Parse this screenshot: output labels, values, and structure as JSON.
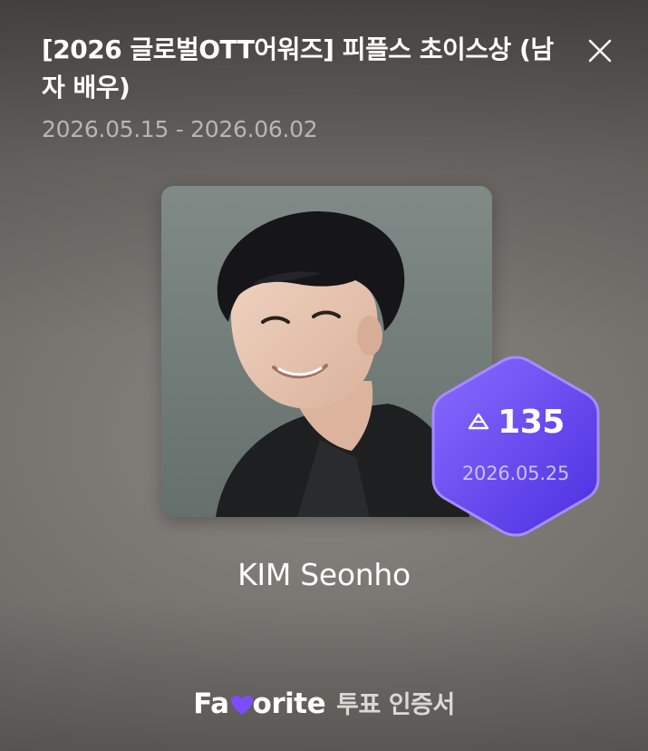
{
  "poll": {
    "title": "[2026 글로벌OTT어워즈] 피플스 초이스상 (남자 배우)",
    "period": "2026.05.15 - 2026.06.02"
  },
  "icons": {
    "close": "close-icon",
    "vote": "vote-icon",
    "heart": "heart-icon"
  },
  "artist": {
    "name": "KIM Seonho"
  },
  "vote_badge": {
    "count": "135",
    "date": "2026.05.25",
    "color": "#6a4cf5"
  },
  "footer": {
    "brand_prefix": "Fa",
    "brand_suffix": "orite",
    "label": "투표 인증서",
    "heart_color": "#7b4dff"
  }
}
